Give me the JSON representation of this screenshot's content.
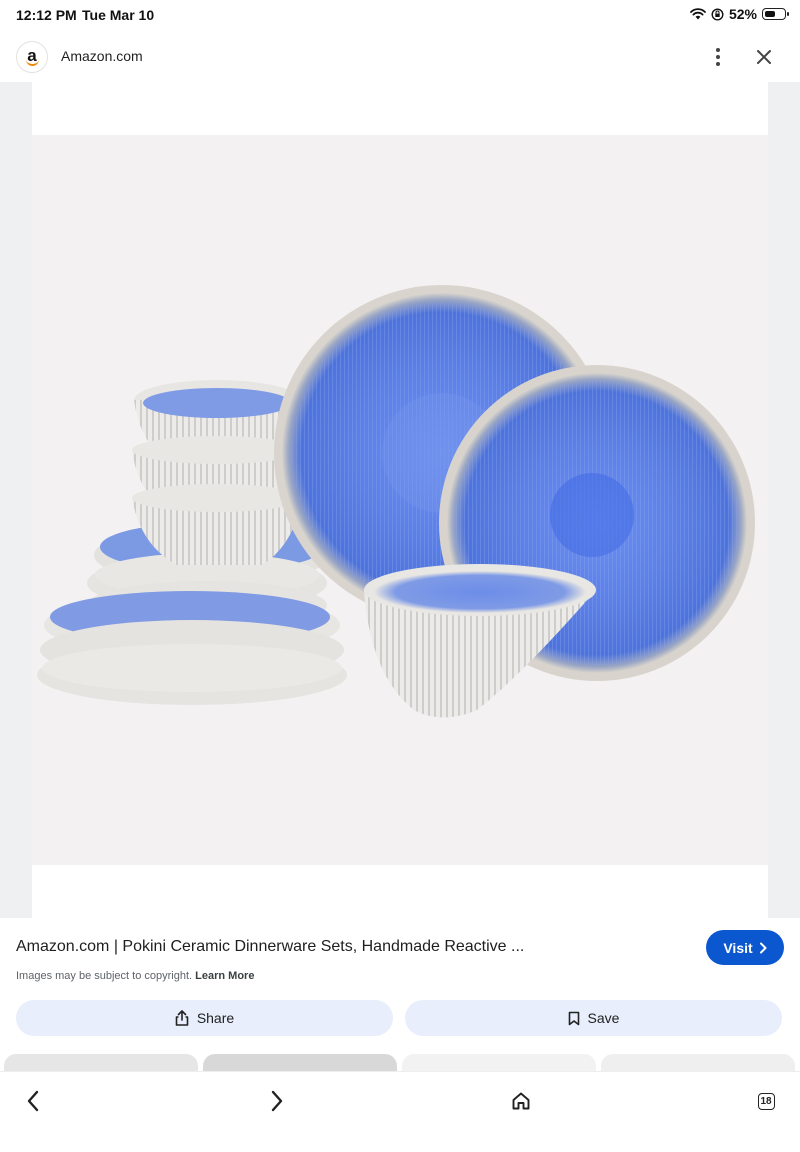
{
  "status_bar": {
    "time": "12:12 PM",
    "date": "Tue Mar 10",
    "battery_percent": "52%",
    "battery_level": 0.52
  },
  "header": {
    "site_name": "Amazon.com",
    "logo_letter": "a",
    "icons": [
      "more-vert-icon",
      "close-icon"
    ]
  },
  "result": {
    "title": "Amazon.com | Pokini Ceramic Dinnerware Sets, Handmade Reactive ...",
    "visit_label": "Visit",
    "copyright_text": "Images may be subject to copyright.",
    "learn_more_label": "Learn More",
    "share_label": "Share",
    "save_label": "Save"
  },
  "colors": {
    "accent": "#0b57d0",
    "action_bg": "#e8eefb",
    "glaze_blue": "#5a7fe6",
    "ceramic_white": "#ecebea"
  },
  "toolbar": {
    "tab_count": "18",
    "icons": [
      "back-icon",
      "forward-icon",
      "home-icon",
      "tabs-icon"
    ]
  }
}
